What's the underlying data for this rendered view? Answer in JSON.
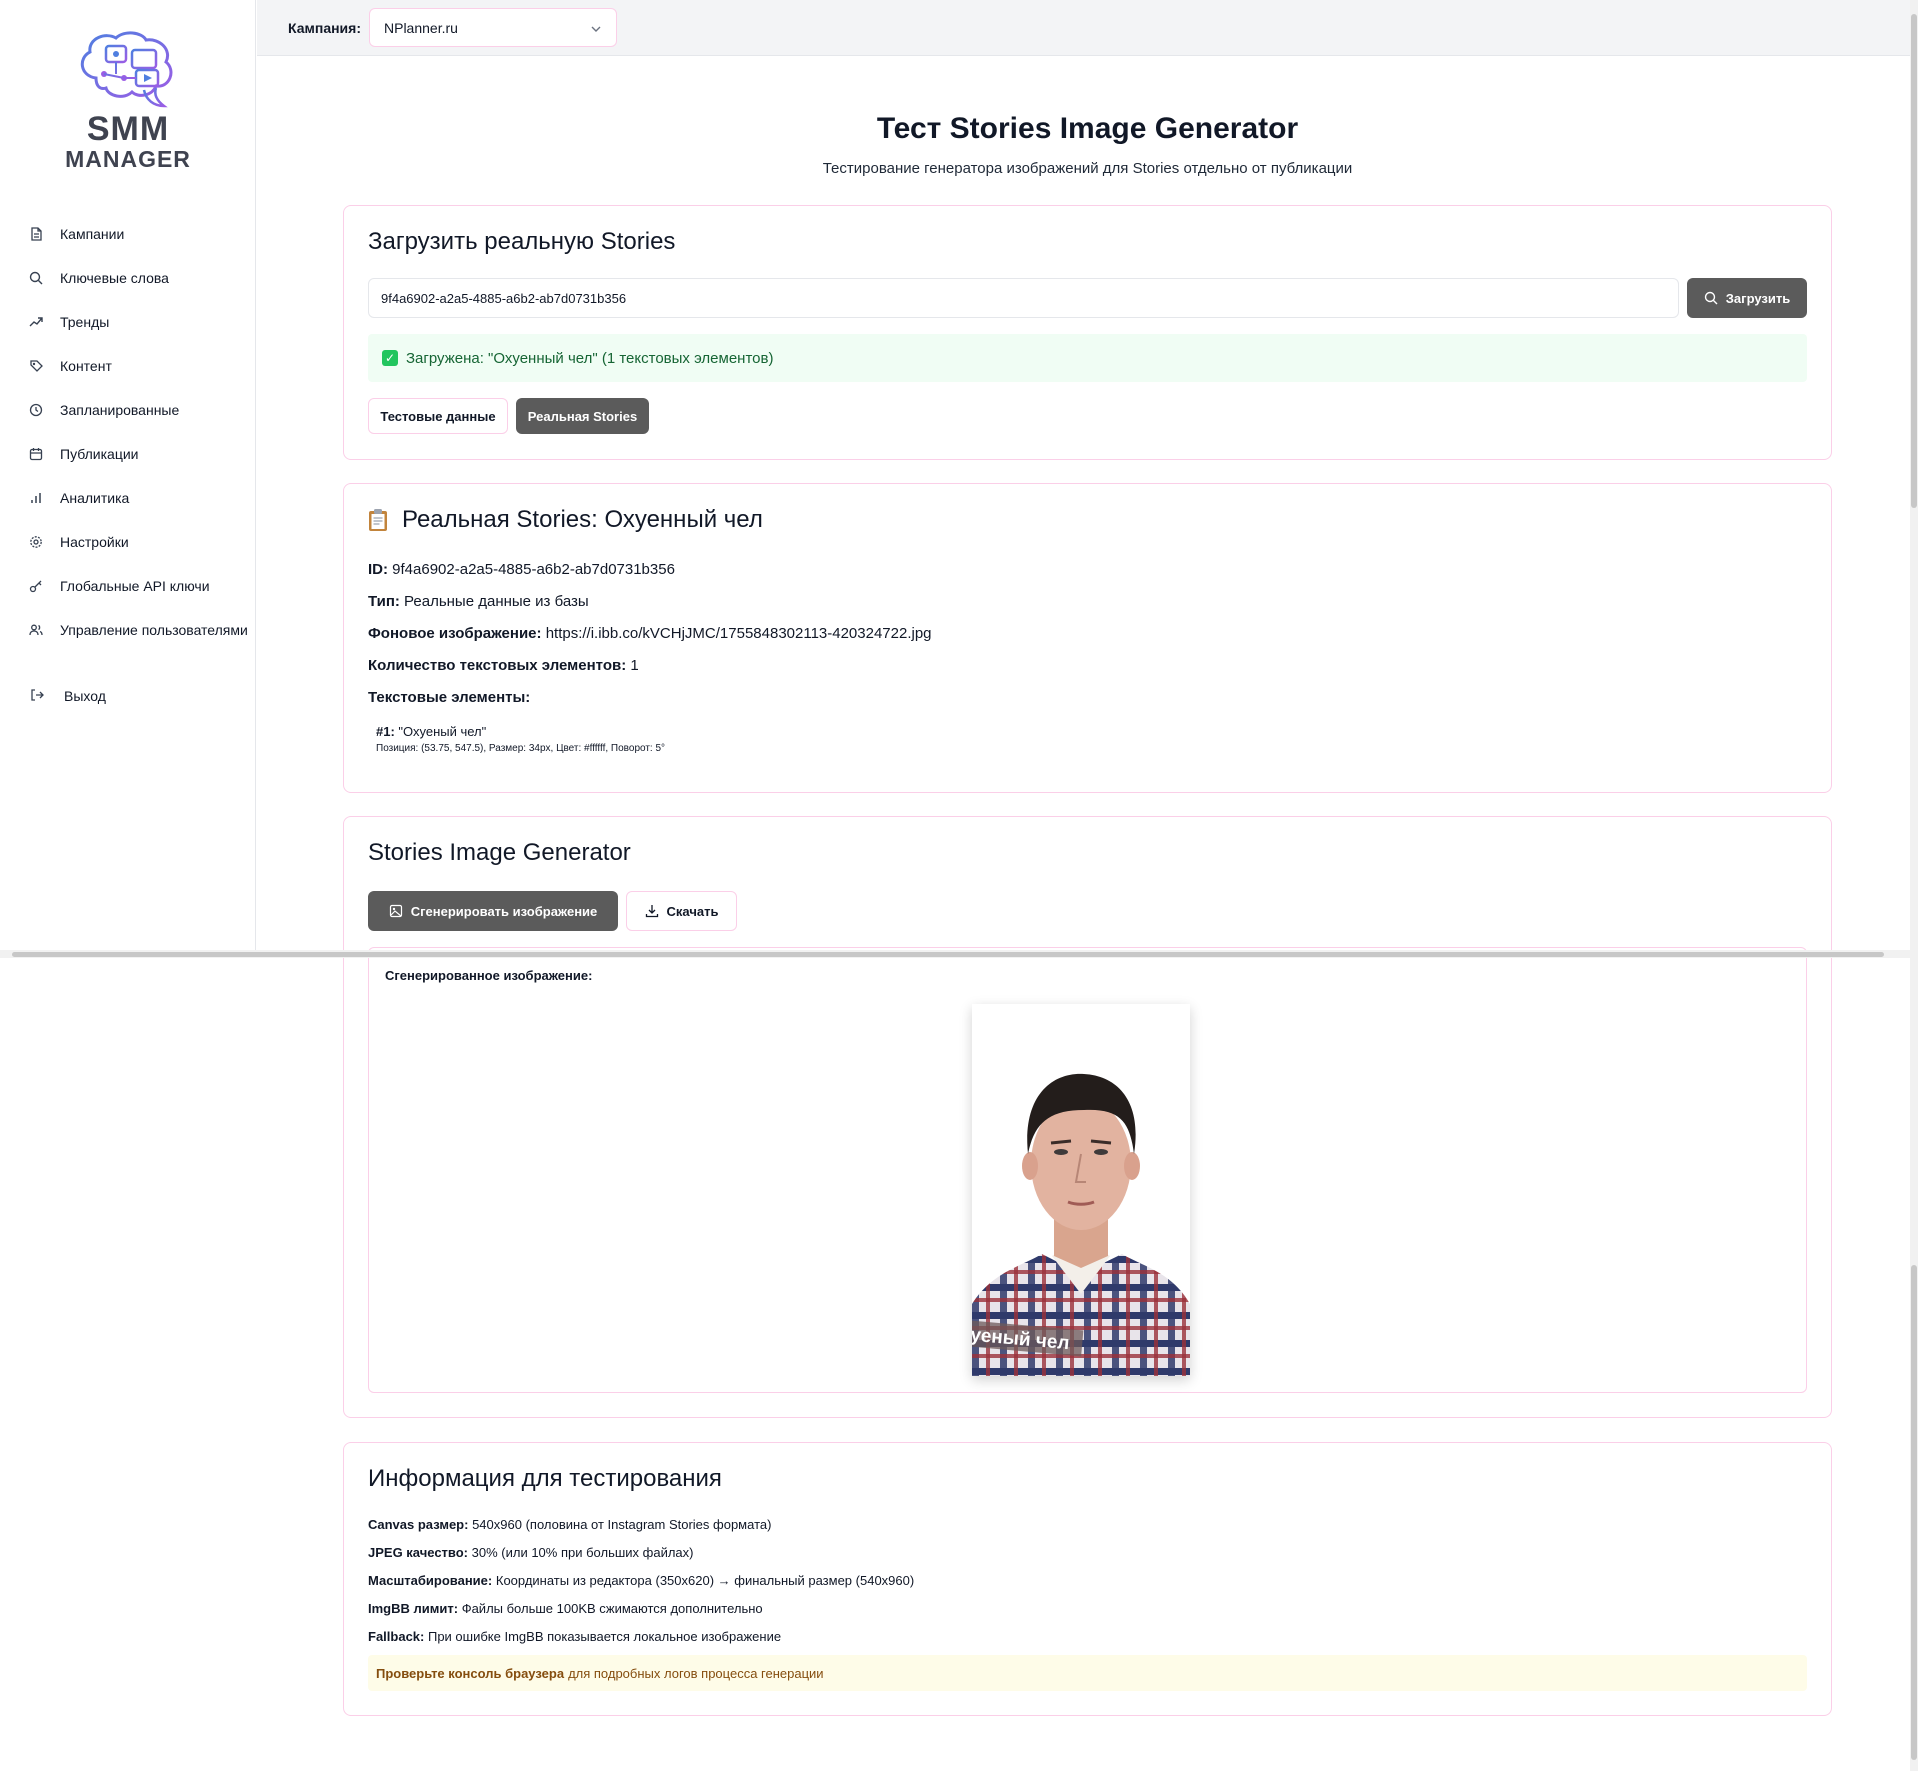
{
  "sidebar": {
    "logo": {
      "line1": "SMM",
      "line2": "MANAGER"
    },
    "items": [
      {
        "label": "Кампании",
        "icon": "document-icon"
      },
      {
        "label": "Ключевые слова",
        "icon": "search-icon"
      },
      {
        "label": "Тренды",
        "icon": "trend-icon"
      },
      {
        "label": "Контент",
        "icon": "palette-icon"
      },
      {
        "label": "Запланированные",
        "icon": "clock-icon"
      },
      {
        "label": "Публикации",
        "icon": "calendar-icon"
      },
      {
        "label": "Аналитика",
        "icon": "bar-chart-icon"
      },
      {
        "label": "Настройки",
        "icon": "gear-icon"
      },
      {
        "label": "Глобальные API ключи",
        "icon": "key-icon"
      },
      {
        "label": "Управление пользователями",
        "icon": "users-icon"
      }
    ],
    "logout": "Выход"
  },
  "topbar": {
    "label": "Кампания:",
    "selected": "NPlanner.ru"
  },
  "page": {
    "title": "Тест Stories Image Generator",
    "subtitle": "Тестирование генератора изображений для Stories отдельно от публикации"
  },
  "load_card": {
    "title": "Загрузить реальную Stories",
    "input_value": "9f4a6902-a2a5-4885-a6b2-ab7d0731b356",
    "load_button": "Загрузить",
    "success": "Загружена: \"Охуенный чел\" (1 текстовых элементов)",
    "tab_test": "Тестовые данные",
    "tab_real": "Реальная Stories"
  },
  "info_card": {
    "title": "Реальная Stories: Охуенный чел",
    "id_label": "ID:",
    "id_value": "9f4a6902-a2a5-4885-a6b2-ab7d0731b356",
    "type_label": "Тип:",
    "type_value": "Реальные данные из базы",
    "bg_label": "Фоновое изображение:",
    "bg_value": "https://i.ibb.co/kVCHjJMC/1755848302113-420324722.jpg",
    "count_label": "Количество текстовых элементов:",
    "count_value": "1",
    "elements_label": "Текстовые элементы:",
    "element_index": "#1:",
    "element_text": "\"Охуеный чел\"",
    "element_details": "Позиция: (53.75, 547.5), Размер: 34px, Цвет: #ffffff, Поворот: 5°"
  },
  "gen_card": {
    "title": "Stories Image Generator",
    "generate_button": "Сгенерировать изображение",
    "download_button": "Скачать",
    "result_label": "Сгенерированное изображение:",
    "overlay_text": "уеный чел"
  },
  "test_card": {
    "title": "Информация для тестирования",
    "lines": [
      {
        "label": "Canvas размер:",
        "value": "540x960 (половина от Instagram Stories формата)"
      },
      {
        "label": "JPEG качество:",
        "value": "30% (или 10% при больших файлах)"
      },
      {
        "label": "Масштабирование:",
        "value": "Координаты из редактора (350x620) → финальный размер (540x960)"
      },
      {
        "label": "ImgBB лимит:",
        "value": "Файлы больше 100KB сжимаются дополнительно"
      },
      {
        "label": "Fallback:",
        "value": "При ошибке ImgBB показывается локальное изображение"
      }
    ],
    "warn_bold": "Проверьте консоль браузера",
    "warn_text": "для подробных логов процесса генерации"
  },
  "colors": {
    "accent_border": "#fbcfe8",
    "button_dark": "#5b5b5b",
    "success_bg": "#f0fdf4",
    "success_text": "#166534",
    "warn_bg": "#fefce8",
    "warn_text": "#854d0e",
    "logo_gradient_start": "#4f7fe0",
    "logo_gradient_end": "#9b5de5"
  }
}
